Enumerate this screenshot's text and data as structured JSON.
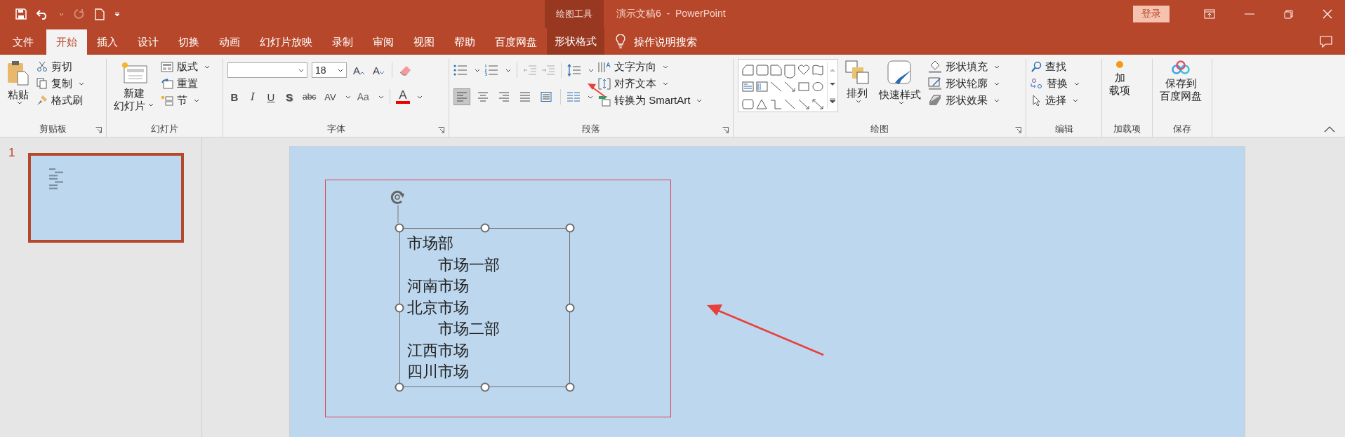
{
  "window": {
    "context_label": "绘图工具",
    "title": "演示文稿6  -  PowerPoint",
    "sign_in": "登录"
  },
  "tabs": [
    {
      "label": "文件",
      "selected": false,
      "kind": "normal"
    },
    {
      "label": "开始",
      "selected": true,
      "kind": "normal"
    },
    {
      "label": "插入",
      "selected": false,
      "kind": "normal"
    },
    {
      "label": "设计",
      "selected": false,
      "kind": "normal"
    },
    {
      "label": "切换",
      "selected": false,
      "kind": "normal"
    },
    {
      "label": "动画",
      "selected": false,
      "kind": "normal"
    },
    {
      "label": "幻灯片放映",
      "selected": false,
      "kind": "normal"
    },
    {
      "label": "录制",
      "selected": false,
      "kind": "normal"
    },
    {
      "label": "审阅",
      "selected": false,
      "kind": "normal"
    },
    {
      "label": "视图",
      "selected": false,
      "kind": "normal"
    },
    {
      "label": "帮助",
      "selected": false,
      "kind": "normal"
    },
    {
      "label": "百度网盘",
      "selected": false,
      "kind": "normal"
    },
    {
      "label": "形状格式",
      "selected": false,
      "kind": "contextual"
    }
  ],
  "tell_me": {
    "placeholder": "操作说明搜索"
  },
  "ribbon": {
    "clipboard": {
      "label": "剪贴板",
      "paste": "粘贴",
      "cut": "剪切",
      "copy": "复制",
      "format_painter": "格式刷"
    },
    "slides": {
      "label": "幻灯片",
      "new_slide": [
        "新建",
        "幻灯片"
      ],
      "layout": "版式",
      "reset": "重置",
      "section": "节"
    },
    "font": {
      "label": "字体",
      "size": "18",
      "grow": "A",
      "shrink": "A",
      "bold": "B",
      "italic": "I",
      "underline": "U",
      "shadow": "S",
      "strike": "abc",
      "spacing": "AV",
      "case": "Aa",
      "font_color_button": "A"
    },
    "paragraph": {
      "label": "段落",
      "align": [
        {
          "kind": "left",
          "selected": true
        },
        {
          "kind": "center",
          "selected": false
        },
        {
          "kind": "right",
          "selected": false
        },
        {
          "kind": "justify",
          "selected": false
        },
        {
          "kind": "distributed",
          "selected": false
        }
      ],
      "text_direction": "文字方向",
      "align_text": "对齐文本",
      "smartart": "转换为 SmartArt"
    },
    "drawing": {
      "label": "绘图",
      "arrange": "排列",
      "quick_styles": "快速样式",
      "fill": "形状填充",
      "outline": "形状轮廓",
      "effects": "形状效果"
    },
    "editing": {
      "label": "编辑",
      "find": "查找",
      "replace": "替换",
      "select": "选择"
    },
    "addins": {
      "label": "加载项",
      "button": [
        "加",
        "载项"
      ]
    },
    "save": {
      "label": "保存",
      "button": [
        "保存到",
        "百度网盘"
      ]
    }
  },
  "slide_pane": {
    "number": "1",
    "selected": true
  },
  "slide": {
    "lines": [
      {
        "text": "市场部",
        "children": [
          {
            "text": "市场一部"
          }
        ]
      },
      {
        "text": "河南市场"
      },
      {
        "text": "北京市场",
        "children": [
          {
            "text": "市场二部"
          }
        ]
      },
      {
        "text": "江西市场"
      },
      {
        "text": "四川市场"
      }
    ]
  }
}
